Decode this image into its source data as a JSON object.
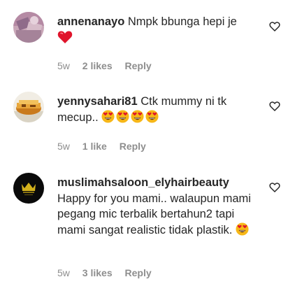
{
  "comments": [
    {
      "username": "annenanayo",
      "text": "Nmpk bbunga hepi je",
      "time": "5w",
      "likes": "2 likes",
      "reply": "Reply",
      "trailing_icon": "red-heart-emoji"
    },
    {
      "username": "yennysahari81",
      "text": "Ctk mummy ni tk mecup..",
      "time": "5w",
      "likes": "1 like",
      "reply": "Reply",
      "trailing_icon": "heart-eyes-emoji x4"
    },
    {
      "username": "muslimahsaloon_elyhairbeauty",
      "text": "Happy for you mami.. walaupun mami pegang mic terbalik bertahun2 tapi mami sangat realistic tidak plastik.",
      "time": "5w",
      "likes": "3 likes",
      "reply": "Reply",
      "trailing_icon": "heart-eyes-emoji"
    }
  ],
  "colors": {
    "text": "#262626",
    "meta": "#8e8e8e",
    "heart_red": "#e0142b",
    "emoji_face": "#f7b718"
  }
}
